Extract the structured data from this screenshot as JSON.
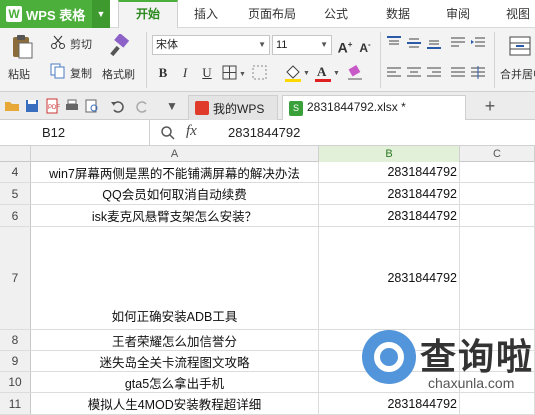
{
  "app": {
    "logo_glyph": "W",
    "name": "WPS 表格",
    "drop_glyph": "▼"
  },
  "menu": [
    "开始",
    "插入",
    "页面布局",
    "公式",
    "数据",
    "审阅",
    "视图"
  ],
  "ribbon": {
    "paste": "粘贴",
    "cut": "剪切",
    "copy": "复制",
    "format_painter": "格式刷",
    "font_name": "宋体",
    "font_size": "11",
    "bold": "B",
    "italic": "I",
    "underline": "U",
    "merge_center": "合并居中",
    "grow_font": "A",
    "shrink_font": "A"
  },
  "tabs": {
    "wps_tab": "我的WPS",
    "file_tab": "2831844792.xlsx *",
    "add_tab": "+"
  },
  "formula_bar": {
    "cell_ref": "B12",
    "fx": "fx",
    "value": "2831844792"
  },
  "columns": [
    "A",
    "B",
    "C"
  ],
  "rows": [
    {
      "num": "4",
      "a": "win7屏幕两侧是黑的不能铺满屏幕的解决办法",
      "b": "2831844792"
    },
    {
      "num": "5",
      "a": "QQ会员如何取消自动续费",
      "b": "2831844792"
    },
    {
      "num": "6",
      "a": "isk麦克风悬臂支架怎么安装？",
      "b": "2831844792"
    },
    {
      "num": "7",
      "a": "如何正确安装ADB工具",
      "b": "2831844792"
    },
    {
      "num": "8",
      "a": "王者荣耀怎么加信誉分",
      "b": ""
    },
    {
      "num": "9",
      "a": "迷失岛全关卡流程图文攻略",
      "b": ""
    },
    {
      "num": "10",
      "a": "gta5怎么拿出手机",
      "b": ""
    },
    {
      "num": "11",
      "a": "模拟人生4MOD安装教程超详细",
      "b": "2831844792"
    }
  ],
  "watermark": {
    "title": "查询啦",
    "sub": "chaxunla.com"
  },
  "colors": {
    "accent": "#4caf3b",
    "selected_col": "#e2efd9",
    "watermark_blue": "#4a8fd8"
  }
}
